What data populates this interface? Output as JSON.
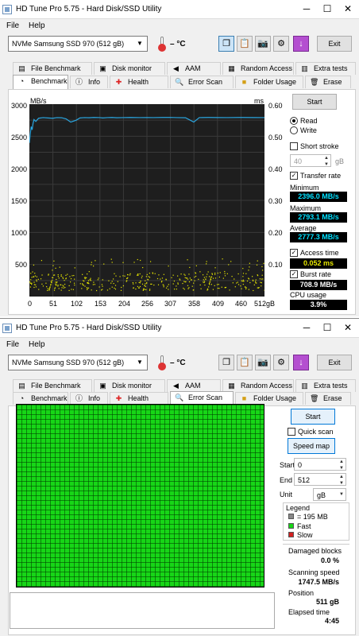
{
  "windows": [
    {
      "title": "HD Tune Pro 5.75 - Hard Disk/SSD Utility",
      "menu": [
        "File",
        "Help"
      ],
      "drive": "NVMe    Samsung SSD 970 (512 gB)",
      "temperature": "– °C",
      "exit_label": "Exit",
      "tabs_top": [
        "File Benchmark",
        "Disk monitor",
        "AAM",
        "Random Access",
        "Extra tests"
      ],
      "tabs_bottom": [
        "Benchmark",
        "Info",
        "Health",
        "Error Scan",
        "Folder Usage",
        "Erase"
      ],
      "selected_tab": "Benchmark"
    },
    {
      "title": "HD Tune Pro 5.75 - Hard Disk/SSD Utility",
      "menu": [
        "File",
        "Help"
      ],
      "drive": "NVMe    Samsung SSD 970 (512 gB)",
      "temperature": "– °C",
      "exit_label": "Exit",
      "tabs_top": [
        "File Benchmark",
        "Disk monitor",
        "AAM",
        "Random Access",
        "Extra tests"
      ],
      "tabs_bottom": [
        "Benchmark",
        "Info",
        "Health",
        "Error Scan",
        "Folder Usage",
        "Erase"
      ],
      "selected_tab": "Error Scan"
    }
  ],
  "benchmark": {
    "start_label": "Start",
    "read_label": "Read",
    "write_label": "Write",
    "short_stroke_label": "Short stroke",
    "short_stroke_value": "40",
    "short_stroke_unit": "gB",
    "transfer_rate_label": "Transfer rate",
    "minimum_label": "Minimum",
    "minimum_value": "2396.0 MB/s",
    "maximum_label": "Maximum",
    "maximum_value": "2793.1 MB/s",
    "average_label": "Average",
    "average_value": "2777.3 MB/s",
    "access_time_label": "Access time",
    "access_time_value": "0.052 ms",
    "burst_rate_label": "Burst rate",
    "burst_rate_value": "708.9 MB/s",
    "cpu_usage_label": "CPU usage",
    "cpu_usage_value": "3.9%"
  },
  "chart_data": {
    "type": "line",
    "ylabel": "MB/s",
    "y2label": "ms",
    "xlim": [
      0,
      512
    ],
    "ylim": [
      0,
      3000
    ],
    "y2lim": [
      0,
      0.6
    ],
    "y_ticks": [
      "500",
      "1000",
      "1500",
      "2000",
      "2500",
      "3000"
    ],
    "y2_ticks": [
      "0.10",
      "0.20",
      "0.30",
      "0.40",
      "0.50",
      "0.60"
    ],
    "x_ticks": [
      "0",
      "51",
      "102",
      "153",
      "204",
      "256",
      "307",
      "358",
      "409",
      "460",
      "512gB"
    ],
    "grid": true,
    "series": [
      {
        "name": "Transfer rate",
        "color": "#2aa6e0",
        "x": [
          0,
          2,
          4,
          6,
          8,
          10,
          14,
          20,
          30,
          40,
          51,
          60,
          70,
          80,
          90,
          102,
          110,
          120,
          130,
          140,
          153,
          160,
          170,
          180,
          190,
          204,
          220,
          240,
          256,
          270,
          290,
          307,
          320,
          340,
          358,
          370,
          390,
          409,
          430,
          460,
          490,
          512
        ],
        "values": [
          2396,
          2540,
          2650,
          2600,
          2700,
          2760,
          2730,
          2780,
          2790,
          2785,
          2780,
          2790,
          2788,
          2770,
          2720,
          2750,
          2785,
          2790,
          2788,
          2792,
          2790,
          2785,
          2790,
          2792,
          2788,
          2790,
          2792,
          2790,
          2791,
          2790,
          2792,
          2793,
          2790,
          2788,
          2720,
          2790,
          2792,
          2791,
          2790,
          2792,
          2791,
          2790
        ]
      }
    ],
    "access_time_ms_range": [
      0.02,
      0.12
    ],
    "access_color": "#e8e800"
  },
  "errorscan": {
    "start_label": "Start",
    "quick_scan_label": "Quick scan",
    "speed_map_label": "Speed map",
    "start_field_label": "Start",
    "start_value": "0",
    "end_field_label": "End",
    "end_value": "512",
    "unit_label": "Unit",
    "unit_value": "gB",
    "legend_title": "Legend",
    "legend_block": "= 195 MB",
    "legend_fast": "Fast",
    "legend_slow": "Slow",
    "block_color": "#17d617",
    "damaged_blocks_label": "Damaged blocks",
    "damaged_blocks_value": "0.0 %",
    "scanning_speed_label": "Scanning speed",
    "scanning_speed_value": "1747.5 MB/s",
    "position_label": "Position",
    "position_value": "511 gB",
    "elapsed_time_label": "Elapsed time",
    "elapsed_time_value": "4:45"
  }
}
